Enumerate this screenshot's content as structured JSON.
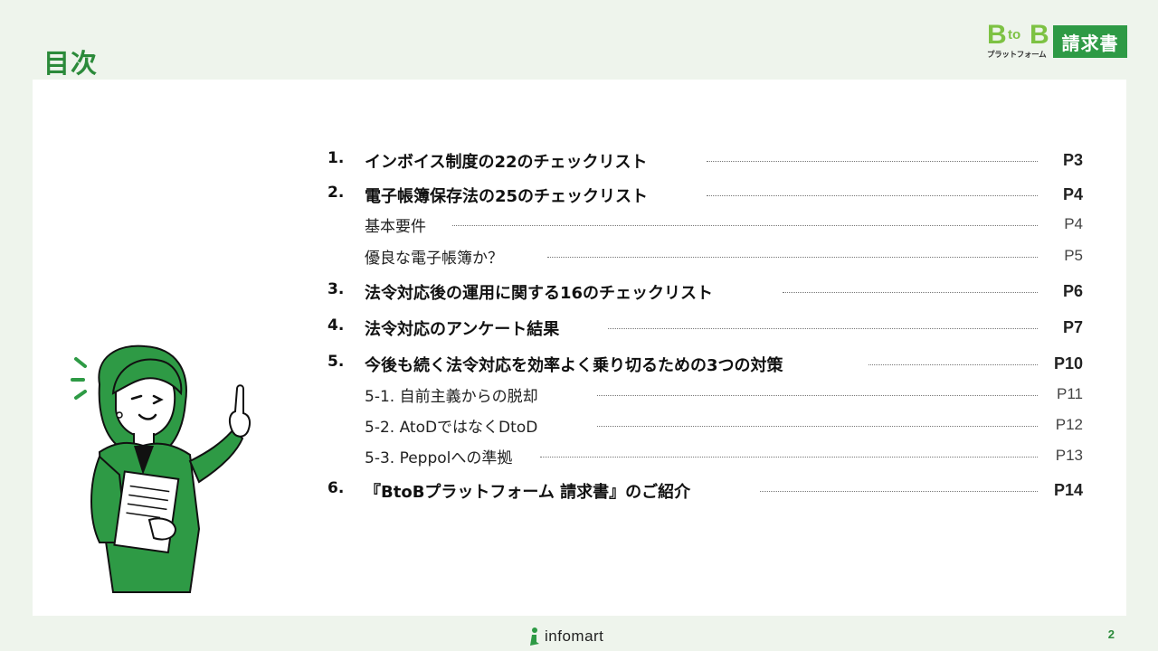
{
  "header": {
    "title": "目次"
  },
  "logo": {
    "b_left": "B",
    "to": "to",
    "b_right": "B",
    "platform": "プラットフォーム",
    "badge": "請求書"
  },
  "toc": [
    {
      "num": "1.",
      "text": "インボイス制度の22のチェックリスト",
      "page": "P3"
    },
    {
      "num": "2.",
      "text": "電子帳簿保存法の25のチェックリスト",
      "page": "P4"
    },
    {
      "num": "",
      "text": "基本要件",
      "page": "P4"
    },
    {
      "num": "",
      "text": "優良な電子帳簿か？",
      "page": "P5"
    },
    {
      "num": "3.",
      "text": "法令対応後の運用に関する16のチェックリスト",
      "page": "P6"
    },
    {
      "num": "4.",
      "text": "法令対応のアンケート結果",
      "page": "P7"
    },
    {
      "num": "5.",
      "text": "今後も続く法令対応を効率よく乗り切るための3つの対策",
      "page": "P10"
    },
    {
      "num": "",
      "text": "5-1. 自前主義からの脱却",
      "page": "P11"
    },
    {
      "num": "",
      "text": "5-2. AtoDではなくDtoD",
      "page": "P12"
    },
    {
      "num": "",
      "text": "5-3. Peppolへの準拠",
      "page": "P13"
    },
    {
      "num": "6.",
      "text": "『BtoBプラットフォーム 請求書』のご紹介",
      "page": "P14"
    }
  ],
  "footer": {
    "brand": "infomart",
    "page_number": "2"
  },
  "colors": {
    "accent": "#2b8a3a",
    "logo_green": "#7dc243",
    "badge_green": "#2e9a45",
    "background": "#eef4ec"
  }
}
